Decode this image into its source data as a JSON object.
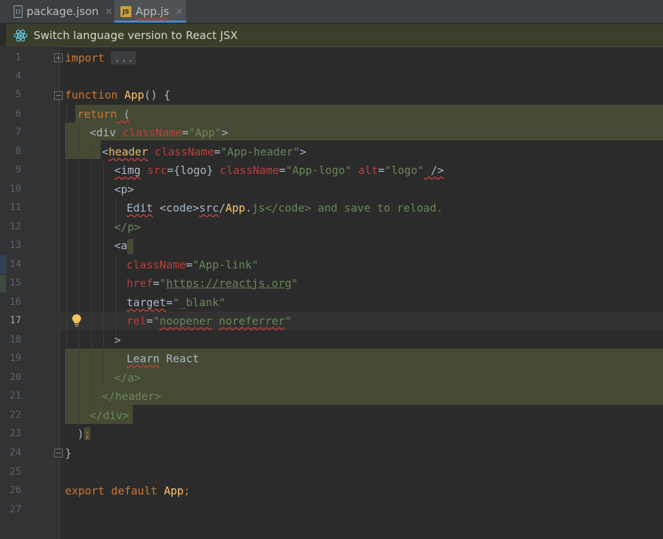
{
  "tabs": [
    {
      "label": "package.json",
      "icon": "json-file-icon",
      "close": "×",
      "active": false
    },
    {
      "label": "App.js",
      "icon": "js-file-icon",
      "icon_text": "JS",
      "close": "×",
      "active": true
    }
  ],
  "banner": {
    "text": "Switch language version to React JSX",
    "icon": "react-icon"
  },
  "colors": {
    "keyword": "#cc7832",
    "function": "#ffc66d",
    "tag": "#e8bf6a",
    "attribute": "#bc3f3c",
    "string": "#6a8759",
    "text": "#a9b7c6"
  },
  "editor": {
    "line_numbers": [
      "1",
      "4",
      "5",
      "6",
      "7",
      "8",
      "9",
      "10",
      "11",
      "12",
      "13",
      "14",
      "15",
      "16",
      "17",
      "18",
      "19",
      "20",
      "21",
      "22",
      "23",
      "24",
      "25",
      "26",
      "27"
    ],
    "current_line": "17",
    "code": {
      "l1_kw": "import",
      "l1_fold": "...",
      "l5_kw": "function",
      "l5_fn": "App",
      "l5_rest": "() {",
      "l6_kw": "return",
      "l6_rest": " (",
      "l7_open": "<div",
      "l7_attr": "className",
      "l7_eq": "=",
      "l7_val": "\"App\"",
      "l7_close": ">",
      "l8_open": "<",
      "l8_tag": "header",
      "l8_attr": "className",
      "l8_eq": "=",
      "l8_val": "\"App-header\"",
      "l8_close": ">",
      "l9_open": "<img",
      "l9_attr1": "src",
      "l9_eq1": "={logo}",
      "l9_attr2": "className",
      "l9_eq2": "=",
      "l9_val2": "\"App-logo\"",
      "l9_attr3": "alt",
      "l9_eq3": "=",
      "l9_val3": "\"logo\"",
      "l9_close": " />",
      "l10": "<p>",
      "l11_edit": "Edit",
      "l11_code_open": "<code>",
      "l11_src": "src",
      "l11_slash": "/",
      "l11_app": "App",
      "l11_dot": ".",
      "l11_js": "js",
      "l11_code_close": "</code>",
      "l11_rest": " and save to reload.",
      "l12": "</p>",
      "l13": "<a",
      "l14_attr": "className",
      "l14_eq": "=",
      "l14_val": "\"App-link\"",
      "l15_attr": "href",
      "l15_eq": "=",
      "l15_q1": "\"",
      "l15_url": "https://reactjs.org",
      "l15_q2": "\"",
      "l16_attr": "target",
      "l16_eq": "=",
      "l16_val": "\"_blank\"",
      "l17_attr": "rel",
      "l17_eq": "=",
      "l17_q1": "\"",
      "l17_v1": "noopener",
      "l17_sp": " ",
      "l17_v2": "noreferrer",
      "l17_q2": "\"",
      "l18": ">",
      "l19_learn": "Learn",
      "l19_react": " React",
      "l20": "</a>",
      "l21": "</header>",
      "l22": "</div>",
      "l23_paren": ")",
      "l23_semi": ";",
      "l24": "}",
      "l26_kw": "export default",
      "l26_name": " App",
      "l26_semi": ";"
    }
  }
}
